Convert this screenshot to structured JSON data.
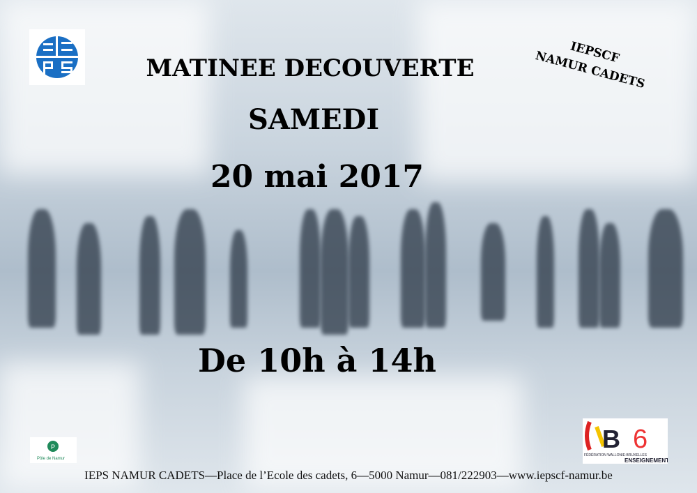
{
  "poster": {
    "title": "MATINEE DECOUVERTE",
    "day": "SAMEDI",
    "date": "20 mai 2017",
    "hours": "De 10h à 14h",
    "corner_line1": "IEPSCF",
    "corner_line2": "NAMUR CADETS",
    "footer": "IEPS NAMUR CADETS—Place de l’Ecole des cadets, 6—5000 Namur—081/222903—www.iepscf-namur.be"
  },
  "logos": {
    "iepscf": "IEPS",
    "namur": "Pôle de Namur",
    "fwb_line1": "FÉDÉRATION WALLONIE-BRUXELLES",
    "fwb_line2": "ENSEIGNEMENT"
  },
  "colors": {
    "logo_blue": "#1a6fc4"
  }
}
